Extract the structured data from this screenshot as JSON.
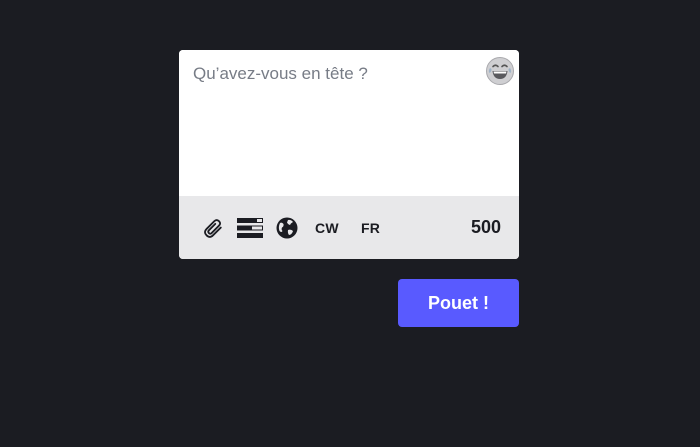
{
  "composer": {
    "placeholder": "Qu’avez-vous en tête ?",
    "emoji_icon": "grinning-face-with-tears-icon",
    "toolbar": {
      "attach_icon": "paperclip-icon",
      "poll_icon": "poll-icon",
      "visibility_icon": "globe-icon",
      "cw_label": "CW",
      "language_label": "FR",
      "char_count": "500"
    }
  },
  "publish": {
    "label": "Pouet !"
  },
  "colors": {
    "background": "#1b1c22",
    "accent": "#595aff",
    "toolbar_bg": "#e8e8ea"
  }
}
